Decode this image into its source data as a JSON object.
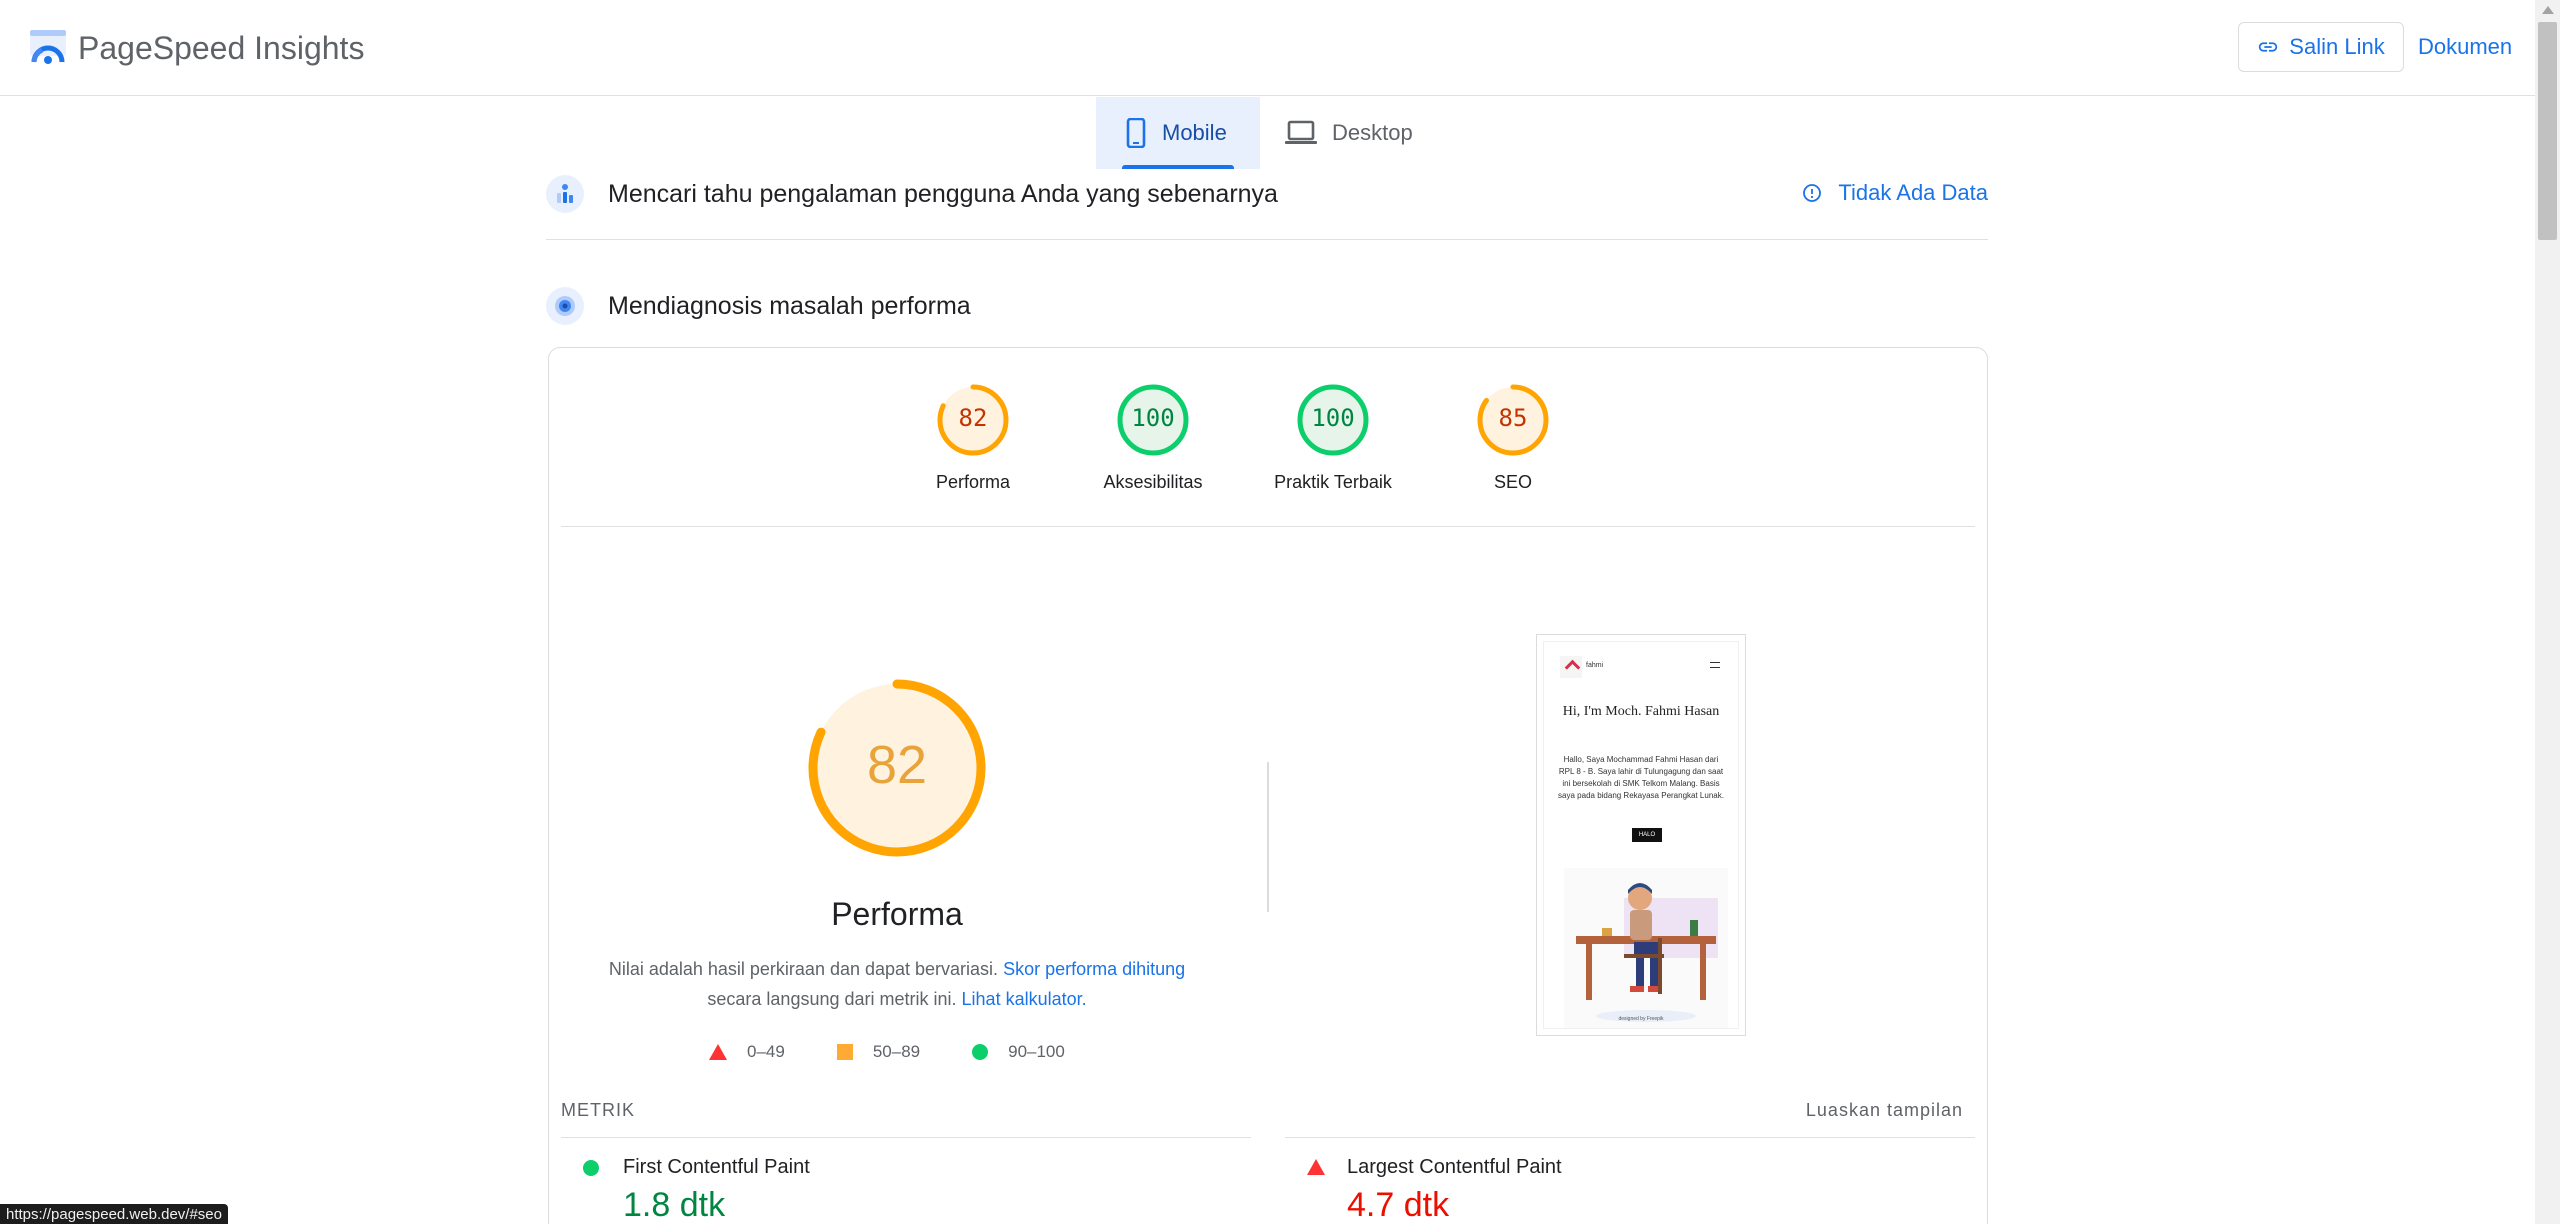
{
  "header": {
    "app_title": "PageSpeed Insights",
    "copy_link_label": "Salin Link",
    "docs_label": "Dokumen"
  },
  "tabs": [
    {
      "label": "Mobile",
      "selected": true
    },
    {
      "label": "Desktop",
      "selected": false
    }
  ],
  "field_data": {
    "title": "Mencari tahu pengalaman pengguna Anda yang sebenarnya",
    "no_data_label": "Tidak Ada Data"
  },
  "diagnose": {
    "title": "Mendiagnosis masalah performa"
  },
  "scores": [
    {
      "label": "Performa",
      "value": "82",
      "fraction": 0.82,
      "color": "#ffa400",
      "text_color": "#c33300",
      "bg": "#fff3e0"
    },
    {
      "label": "Aksesibilitas",
      "value": "100",
      "fraction": 1.0,
      "color": "#0cce6b",
      "text_color": "#018642",
      "bg": "#e6f4ea"
    },
    {
      "label": "Praktik Terbaik",
      "value": "100",
      "fraction": 1.0,
      "color": "#0cce6b",
      "text_color": "#018642",
      "bg": "#e6f4ea"
    },
    {
      "label": "SEO",
      "value": "85",
      "fraction": 0.85,
      "color": "#ffa400",
      "text_color": "#c33300",
      "bg": "#fff3e0"
    }
  ],
  "performance": {
    "score": "82",
    "fraction": 0.82,
    "title": "Performa",
    "desc_1": "Nilai adalah hasil perkiraan dan dapat bervariasi.",
    "desc_link_1": "Skor performa dihitung",
    "desc_2": "secara langsung dari metrik ini.",
    "desc_link_2": "Lihat kalkulator."
  },
  "legend": [
    {
      "shape": "triangle",
      "label": "0–49"
    },
    {
      "shape": "square",
      "label": "50–89"
    },
    {
      "shape": "circle",
      "label": "90–100"
    }
  ],
  "screenshot": {
    "site_name": "fahmi",
    "heading": "Hi, I'm Moch. Fahmi Hasan",
    "body": "Hallo, Saya Mochammad Fahmi Hasan dari RPL 8 - B. Saya lahir di Tulungagung dan saat ini bersekolah di SMK Telkom Malang. Basis saya pada bidang Rekayasa Perangkat Lunak.",
    "button": "HALO",
    "credit": "designed by Freepik"
  },
  "metrics": {
    "section_label": "METRIK",
    "expand_label": "Luaskan tampilan",
    "items": [
      {
        "name": "First Contentful Paint",
        "value": "1.8 dtk",
        "status": "good",
        "color": "#018642"
      },
      {
        "name": "Largest Contentful Paint",
        "value": "4.7 dtk",
        "status": "poor",
        "color": "#eb0f00"
      }
    ]
  },
  "status_bar": {
    "url": "https://pagespeed.web.dev/#seo"
  }
}
